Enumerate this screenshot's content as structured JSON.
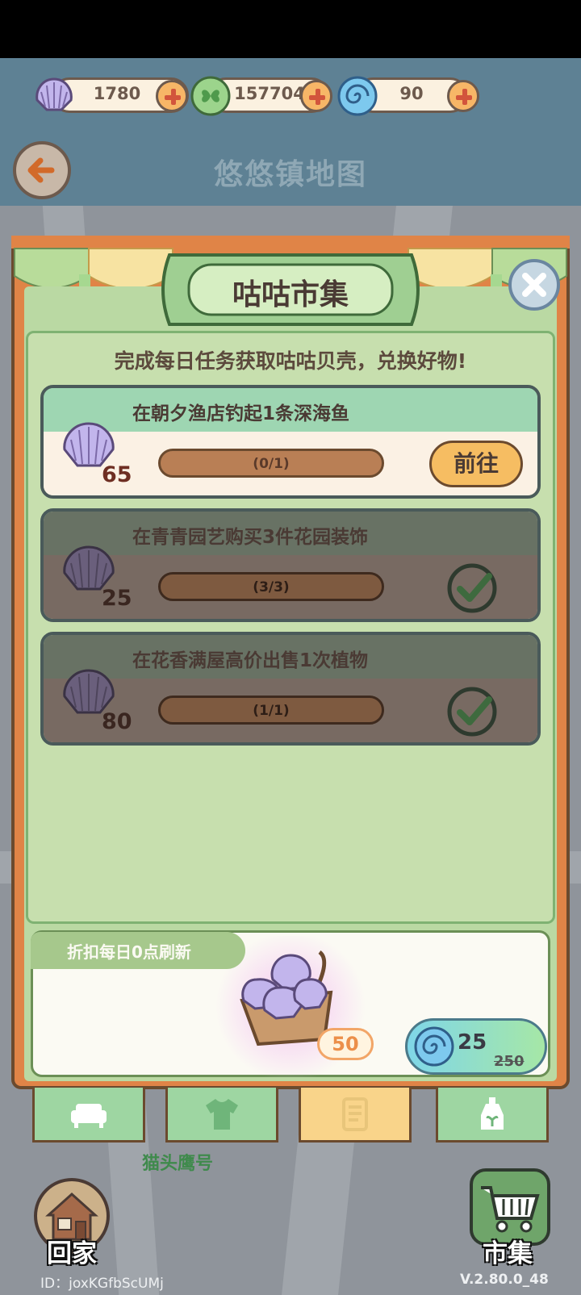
{
  "currencies": {
    "shells": {
      "value": "1780",
      "icon": "shell-icon"
    },
    "clover": {
      "value": "157704",
      "icon": "clover-icon"
    },
    "swirl": {
      "value": "90",
      "icon": "swirl-icon"
    }
  },
  "header": {
    "title": "悠悠镇地图"
  },
  "market": {
    "title": "咕咕市集",
    "subtitle": "完成每日任务获取咕咕贝壳，兑换好物!",
    "tasks": [
      {
        "name": "在朝夕渔店钓起1条深海鱼",
        "reward": "65",
        "progress": "(0/1)",
        "progress_fraction": 0,
        "action": "前往",
        "status": "active"
      },
      {
        "name": "在青青园艺购买3件花园装饰",
        "reward": "25",
        "progress": "(3/3)",
        "progress_fraction": 1,
        "status": "done"
      },
      {
        "name": "在花香满屋高价出售1次植物",
        "reward": "80",
        "progress": "(1/1)",
        "progress_fraction": 1,
        "status": "done"
      }
    ],
    "deal": {
      "tag": "折扣每日0点刷新",
      "quantity": "50",
      "price": "25",
      "old_price": "250"
    },
    "tabs": [
      {
        "icon": "sofa-icon"
      },
      {
        "icon": "shirt-icon"
      },
      {
        "icon": "scroll-icon",
        "active": true
      },
      {
        "icon": "bottle-icon"
      }
    ]
  },
  "map": {
    "shop_label": "猫头鹰号"
  },
  "bottom": {
    "home_label": "回家",
    "market_label": "市集",
    "uid": "ID：joxKGfbScUMj",
    "version": "V.2.80.0_48"
  },
  "colors": {
    "panel_green": "#c7dfae",
    "frame_orange": "#e08447",
    "topbar": "#5e8194",
    "active_head": "#9ed6b2",
    "done_body": "#786a62"
  }
}
